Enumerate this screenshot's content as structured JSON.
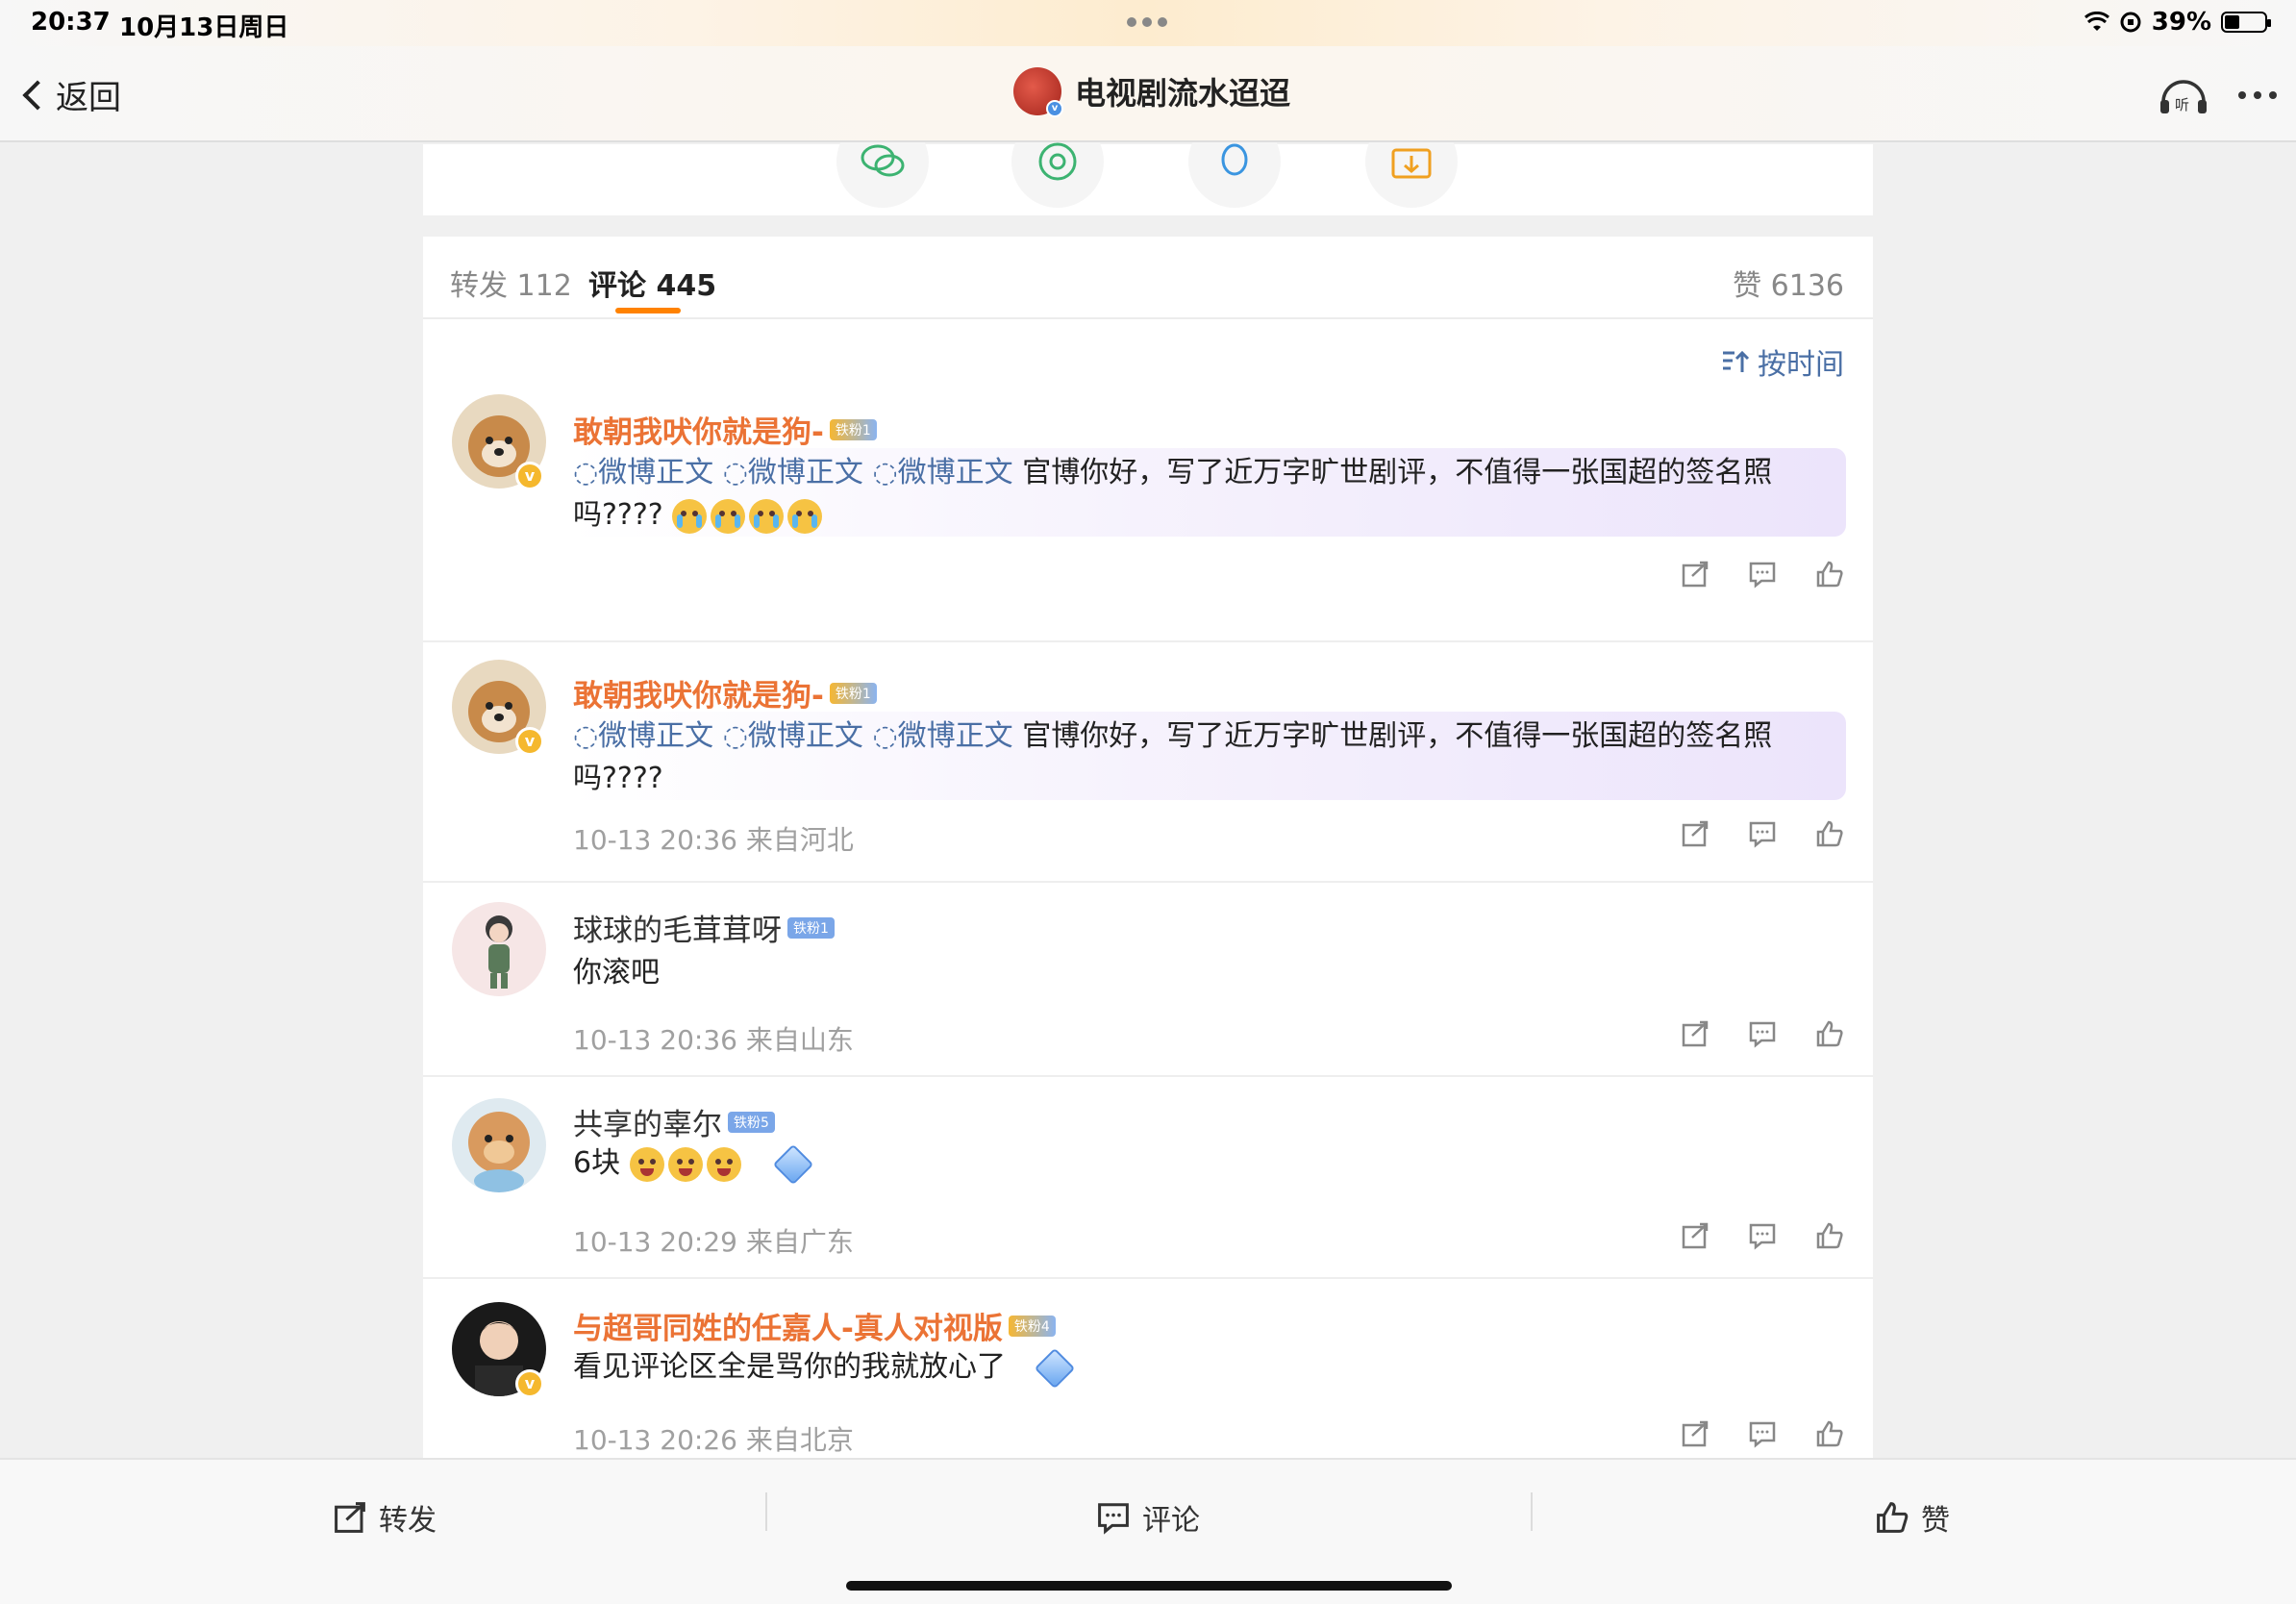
{
  "status": {
    "time": "20:37",
    "date": "10月13日周日",
    "battery": "39%"
  },
  "nav": {
    "back_label": "返回",
    "title": "电视剧流水迢迢",
    "listen_label": "听"
  },
  "tabs": {
    "repost": "转发 112",
    "comment": "评论 445",
    "like": "赞 6136"
  },
  "sort": {
    "label": "按时间"
  },
  "comments": [
    {
      "name": "敢朝我吠你就是狗-",
      "badge": "铁粉1",
      "links": [
        "◌微博正文",
        "◌微博正文",
        "◌微博正文"
      ],
      "text_line1": "官博你好，写了近万字旷世剧评，不值得一张国超的签名照",
      "text_line2": "吗????",
      "meta": ""
    },
    {
      "name": "敢朝我吠你就是狗-",
      "badge": "铁粉1",
      "links": [
        "◌微博正文",
        "◌微博正文",
        "◌微博正文"
      ],
      "text_line1": "官博你好，写了近万字旷世剧评，不值得一张国超的签名照",
      "text_line2": "吗????",
      "meta": "10-13 20:36 来自河北"
    },
    {
      "name": "球球的毛茸茸呀",
      "badge": "铁粉1",
      "text": "你滚吧",
      "meta": "10-13 20:36 来自山东"
    },
    {
      "name": "共享的辜尔",
      "badge": "铁粉5",
      "text": "6块",
      "meta": "10-13 20:29 来自广东"
    },
    {
      "name": "与超哥同姓的任嘉人-真人对视版",
      "badge": "铁粉4",
      "text": "看见评论区全是骂你的我就放心了",
      "meta": "10-13 20:26 来自北京"
    }
  ],
  "bottom": {
    "repost": "转发",
    "comment": "评论",
    "like": "赞"
  },
  "colors": {
    "accent": "#ff8200",
    "name_orange": "#eb7335",
    "link_blue": "#4a6fa5"
  }
}
